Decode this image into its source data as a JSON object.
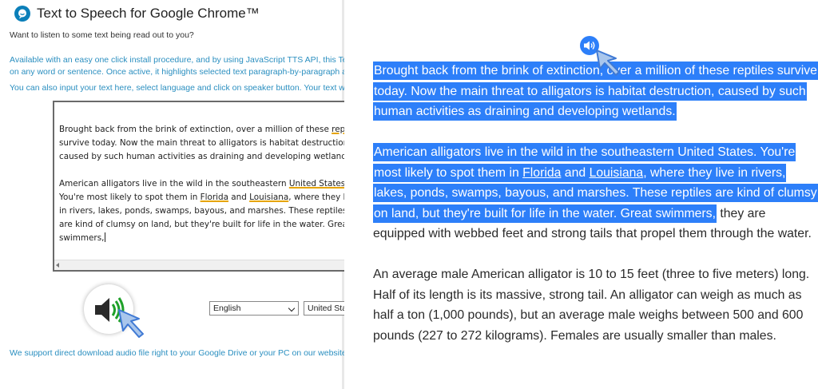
{
  "extension": {
    "title": "Text to Speech for Google Chrome™",
    "intro": "Want to listen to some text being read out to you?",
    "desc_lines": [
      "Available with an easy one click install procedure, and by using JavaScript TTS API, this Text to Speech too",
      "on any word or sentence. Once active, it highlights selected text paragraph-by-paragraph and users are a"
    ],
    "input_hint": "You can also input your text here, select language and click on speaker button. Your text will be prononc",
    "editor": {
      "p1_before": "Brought back from the brink of extinction, over a million of these ",
      "p1_u1": "reptiles",
      "p1_after": " survive today. Now the main threat to alligators is habitat destruction, caused by such human activities as draining and developing wetlands.",
      "p2_before": "American alligators live in the wild in the southeastern ",
      "p2_u1": "United States",
      "p2_mid1": ". You're most likely to spot them in ",
      "p2_u2": "Florida",
      "p2_mid2": " and ",
      "p2_u3": "Louisiana",
      "p2_after": ", where they live in rivers, lakes, ponds, swamps, bayous, and marshes. These reptiles are kind of clumsy on land, but they're built for life in the water. Great swimmers,"
    },
    "language_selected": "English",
    "region_selected": "United Sta",
    "footer_note": "We support direct download audio file right to your Google Drive or your PC on our website."
  },
  "article": {
    "p1": "Brought back from the brink of extinction, over a million of these reptiles survive today. Now the main threat to alligators is habitat destruction, caused by such human activities as draining and developing wetlands.",
    "p2_hl_before": "American alligators live in the wild in the southeastern United States. You're most likely to spot them in ",
    "p2_hl_u1": "Florida",
    "p2_hl_mid": " and ",
    "p2_hl_u2": "Louisiana",
    "p2_hl_after": ", where they live in rivers, lakes, ponds, swamps, bayous, and marshes. These reptiles are kind of clumsy on land, but they're built for life in the water. Great swimmers,",
    "p2_rest": " they are equipped with webbed feet and strong tails that propel them through the water.",
    "p3": "An average male American alligator is 10 to 15 feet (three to five meters) long. Half of its length is its massive, strong tail. An alligator can weigh as much as half a ton (1,000 pounds), but an average male weighs between 500 and 600 pounds (227 to 272 kilograms). Females are usually smaller than males."
  },
  "colors": {
    "highlight": "#2d7ff9",
    "link_blue": "#2b8fc0",
    "speaker_green": "#1fa12a",
    "underline_amber": "#e6a400"
  },
  "icons": [
    "speech-bubble-logo-icon",
    "speaker-icon",
    "sound-wave-icon",
    "mouse-pointer-icon"
  ]
}
